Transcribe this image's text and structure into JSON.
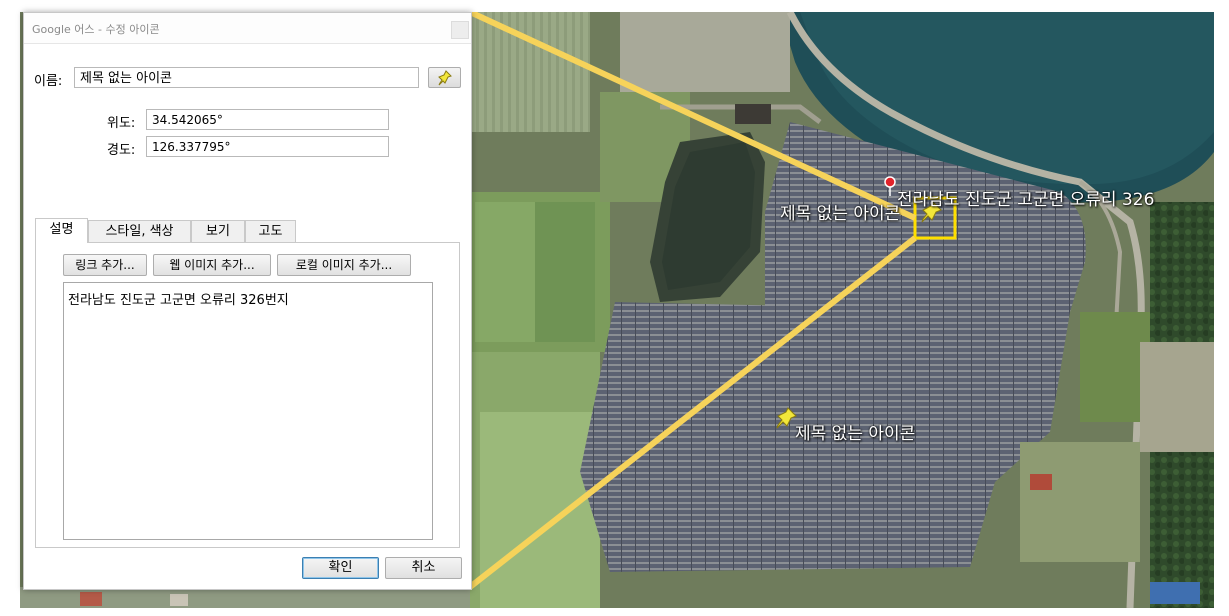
{
  "dialog": {
    "title": "Google 어스 - 수정 아이콘",
    "name_label": "이름:",
    "name_value": "제목 없는 아이콘",
    "latitude_label": "위도:",
    "latitude_value": "34.542065°",
    "longitude_label": "경도:",
    "longitude_value": "126.337795°",
    "tabs": [
      {
        "label": "설명",
        "active": true
      },
      {
        "label": "스타일, 색상",
        "active": false
      },
      {
        "label": "보기",
        "active": false
      },
      {
        "label": "고도",
        "active": false
      }
    ],
    "add_link_label": "링크 추가...",
    "add_web_image_label": "웹 이미지 추가...",
    "add_local_image_label": "로컬 이미지 추가...",
    "description": "전라남도 진도군 고군면 오류리 326번지",
    "ok_label": "확인",
    "cancel_label": "취소"
  },
  "map": {
    "address_placemark_label": "전라남도 진도군 고군면 오류리 326",
    "selected_placemark_label": "제목 없는 아이콘",
    "lower_placemark_label": "제목 없는 아이콘",
    "pin_icon": "yellow-pushpin-icon",
    "address_icon": "red-placemark-icon",
    "highlight_color": "#ffe000",
    "callout_color": "#f6d35a"
  }
}
